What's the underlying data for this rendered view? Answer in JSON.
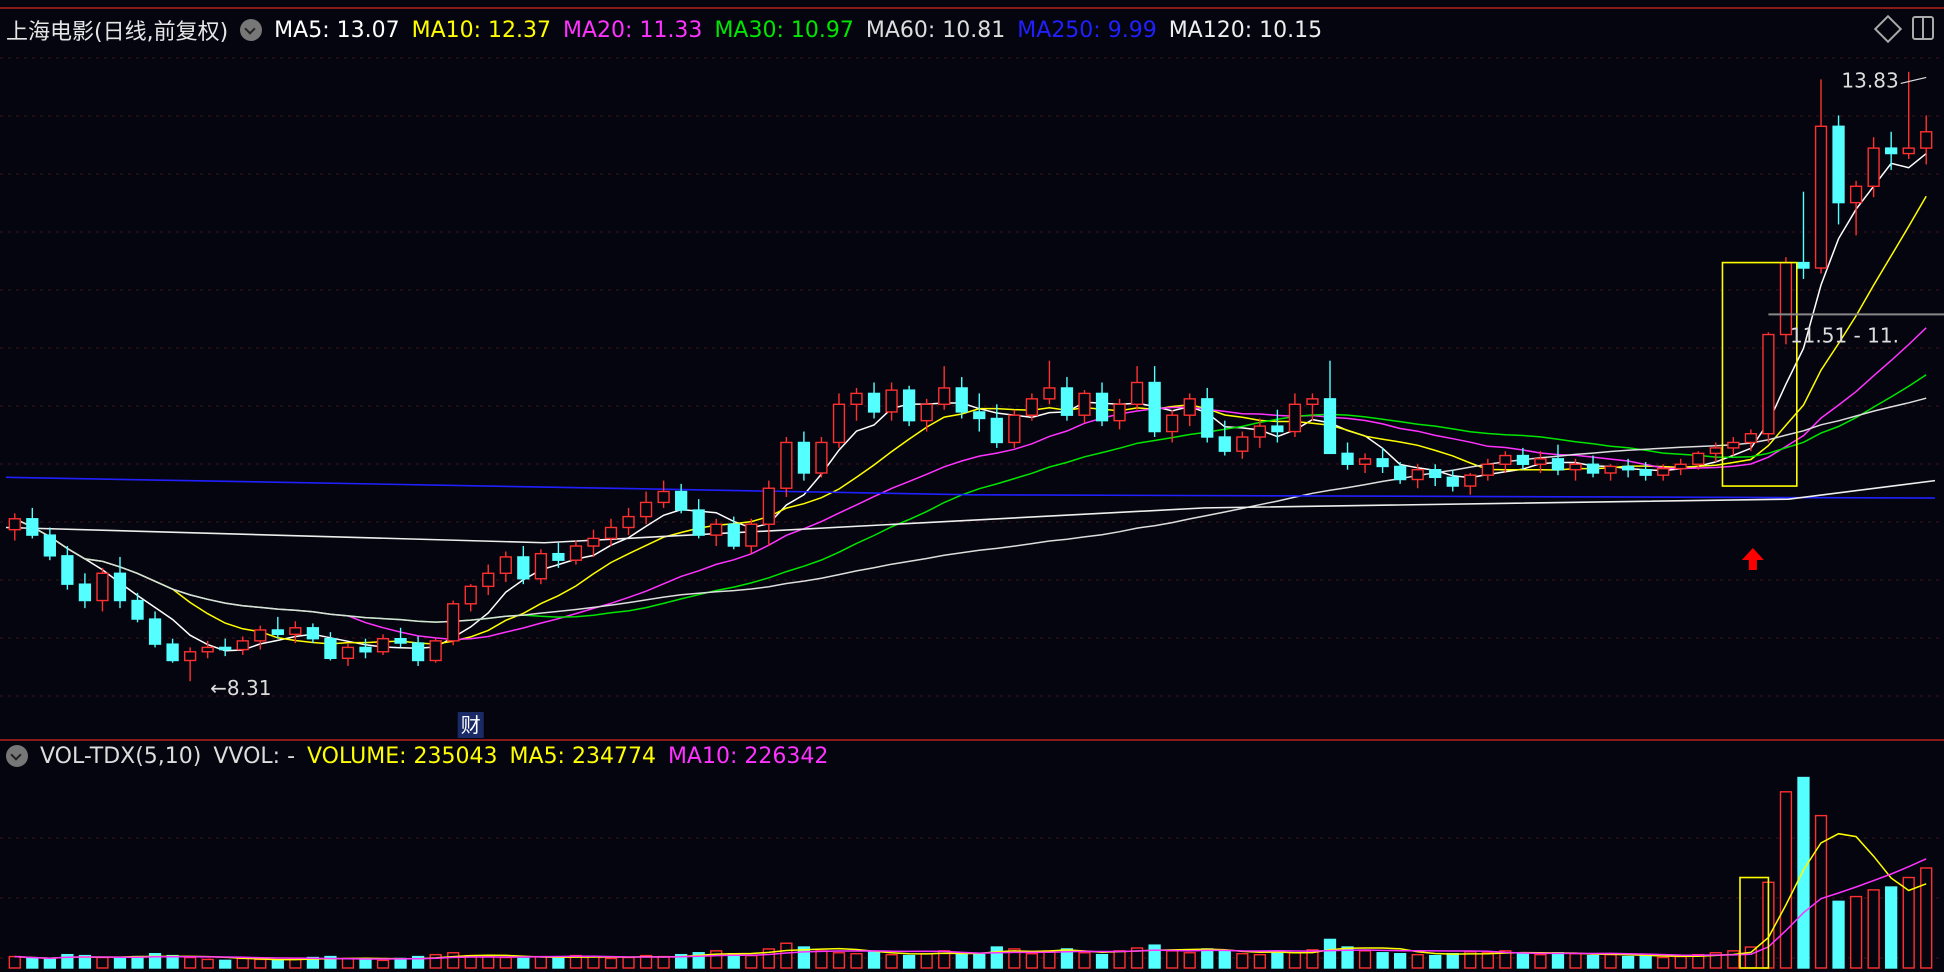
{
  "main_panel": {
    "title": "上海电影(日线,前复权)",
    "indicators": [
      {
        "label": "MA5: 13.07",
        "color": "#ffffff"
      },
      {
        "label": "MA10: 12.37",
        "color": "#ffff00"
      },
      {
        "label": "MA20: 11.33",
        "color": "#ff33ff"
      },
      {
        "label": "MA30: 10.97",
        "color": "#00e600"
      },
      {
        "label": "MA60: 10.81",
        "color": "#dddddd"
      },
      {
        "label": "MA250: 9.99",
        "color": "#2020ff"
      },
      {
        "label": "MA120: 10.15",
        "color": "#eeeeee"
      }
    ],
    "high_label": "13.83",
    "low_label": "8.31",
    "range_label": "11.51 - 11.",
    "event_marker": "财"
  },
  "volume_panel": {
    "title": "VOL-TDX(5,10)",
    "indicators": [
      {
        "label": "VVOL: -",
        "color": "#dddddd"
      },
      {
        "label": "VOLUME: 235043",
        "color": "#ffff00"
      },
      {
        "label": "MA5: 234774",
        "color": "#ffff00"
      },
      {
        "label": "MA10: 226342",
        "color": "#ff33ff"
      }
    ]
  },
  "colors": {
    "background": "#05050f",
    "up": "#ff3030",
    "down": "#54ffff",
    "grid": "#3a1414",
    "highlight_box": "#ffff00",
    "arrow": "#ff0000"
  },
  "chart_data": {
    "type": "candlestick",
    "title": "上海电影(日线,前复权)",
    "ylim": [
      8.0,
      14.1
    ],
    "moving_averages": [
      {
        "name": "MA5",
        "last": 13.07
      },
      {
        "name": "MA10",
        "last": 12.37
      },
      {
        "name": "MA20",
        "last": 11.33
      },
      {
        "name": "MA30",
        "last": 10.97
      },
      {
        "name": "MA60",
        "last": 10.81
      },
      {
        "name": "MA250",
        "last": 9.99
      },
      {
        "name": "MA120",
        "last": 10.15
      }
    ],
    "period_high": 13.83,
    "period_low": 8.31,
    "volume": {
      "last": 235043,
      "ma5": 234774,
      "ma10": 226342
    },
    "ohlc": [
      [
        9.7,
        9.85,
        9.6,
        9.8
      ],
      [
        9.8,
        9.9,
        9.62,
        9.65
      ],
      [
        9.65,
        9.72,
        9.42,
        9.46
      ],
      [
        9.46,
        9.55,
        9.15,
        9.2
      ],
      [
        9.2,
        9.3,
        8.98,
        9.05
      ],
      [
        9.05,
        9.35,
        8.95,
        9.3
      ],
      [
        9.3,
        9.45,
        8.98,
        9.05
      ],
      [
        9.05,
        9.12,
        8.85,
        8.88
      ],
      [
        8.88,
        8.95,
        8.62,
        8.65
      ],
      [
        8.65,
        8.7,
        8.48,
        8.5
      ],
      [
        8.5,
        8.62,
        8.31,
        8.58
      ],
      [
        8.58,
        8.68,
        8.52,
        8.62
      ],
      [
        8.62,
        8.7,
        8.54,
        8.6
      ],
      [
        8.6,
        8.72,
        8.55,
        8.68
      ],
      [
        8.68,
        8.82,
        8.6,
        8.78
      ],
      [
        8.78,
        8.9,
        8.7,
        8.74
      ],
      [
        8.74,
        8.86,
        8.66,
        8.8
      ],
      [
        8.8,
        8.84,
        8.66,
        8.7
      ],
      [
        8.7,
        8.76,
        8.5,
        8.52
      ],
      [
        8.52,
        8.66,
        8.45,
        8.62
      ],
      [
        8.62,
        8.7,
        8.52,
        8.58
      ],
      [
        8.58,
        8.74,
        8.55,
        8.7
      ],
      [
        8.7,
        8.8,
        8.62,
        8.66
      ],
      [
        8.66,
        8.72,
        8.45,
        8.5
      ],
      [
        8.5,
        8.7,
        8.48,
        8.68
      ],
      [
        8.68,
        9.05,
        8.64,
        9.02
      ],
      [
        9.02,
        9.2,
        8.95,
        9.18
      ],
      [
        9.18,
        9.38,
        9.1,
        9.3
      ],
      [
        9.3,
        9.5,
        9.22,
        9.45
      ],
      [
        9.45,
        9.55,
        9.2,
        9.25
      ],
      [
        9.25,
        9.52,
        9.2,
        9.48
      ],
      [
        9.48,
        9.58,
        9.35,
        9.42
      ],
      [
        9.42,
        9.6,
        9.38,
        9.55
      ],
      [
        9.55,
        9.7,
        9.45,
        9.62
      ],
      [
        9.62,
        9.8,
        9.55,
        9.72
      ],
      [
        9.72,
        9.9,
        9.65,
        9.82
      ],
      [
        9.82,
        10.05,
        9.75,
        9.95
      ],
      [
        9.95,
        10.15,
        9.9,
        10.05
      ],
      [
        10.05,
        10.12,
        9.85,
        9.88
      ],
      [
        9.88,
        9.98,
        9.62,
        9.65
      ],
      [
        9.65,
        9.8,
        9.55,
        9.75
      ],
      [
        9.75,
        9.82,
        9.52,
        9.55
      ],
      [
        9.55,
        9.8,
        9.48,
        9.75
      ],
      [
        9.75,
        10.15,
        9.55,
        10.08
      ],
      [
        10.08,
        10.55,
        10.0,
        10.5
      ],
      [
        10.5,
        10.6,
        10.15,
        10.22
      ],
      [
        10.22,
        10.55,
        10.18,
        10.5
      ],
      [
        10.5,
        10.95,
        10.45,
        10.85
      ],
      [
        10.85,
        11.0,
        10.7,
        10.95
      ],
      [
        10.95,
        11.05,
        10.72,
        10.78
      ],
      [
        10.78,
        11.05,
        10.7,
        10.98
      ],
      [
        10.98,
        11.02,
        10.65,
        10.7
      ],
      [
        10.7,
        10.9,
        10.6,
        10.85
      ],
      [
        10.85,
        11.2,
        10.8,
        11.0
      ],
      [
        11.0,
        11.1,
        10.72,
        10.78
      ],
      [
        10.78,
        10.95,
        10.6,
        10.72
      ],
      [
        10.72,
        10.85,
        10.45,
        10.5
      ],
      [
        10.5,
        10.8,
        10.45,
        10.75
      ],
      [
        10.75,
        10.95,
        10.7,
        10.9
      ],
      [
        10.9,
        11.25,
        10.85,
        11.0
      ],
      [
        11.0,
        11.1,
        10.7,
        10.75
      ],
      [
        10.75,
        10.98,
        10.68,
        10.95
      ],
      [
        10.95,
        11.05,
        10.65,
        10.7
      ],
      [
        10.7,
        10.9,
        10.62,
        10.85
      ],
      [
        10.85,
        11.2,
        10.8,
        11.05
      ],
      [
        11.05,
        11.2,
        10.55,
        10.6
      ],
      [
        10.6,
        10.8,
        10.5,
        10.75
      ],
      [
        10.75,
        10.95,
        10.65,
        10.9
      ],
      [
        10.9,
        11.0,
        10.5,
        10.55
      ],
      [
        10.55,
        10.7,
        10.38,
        10.42
      ],
      [
        10.42,
        10.6,
        10.35,
        10.55
      ],
      [
        10.55,
        10.72,
        10.45,
        10.65
      ],
      [
        10.65,
        10.8,
        10.5,
        10.6
      ],
      [
        10.6,
        10.95,
        10.55,
        10.85
      ],
      [
        10.85,
        10.95,
        10.7,
        10.9
      ],
      [
        10.9,
        11.25,
        10.85,
        10.4
      ],
      [
        10.4,
        10.5,
        10.25,
        10.3
      ],
      [
        10.3,
        10.4,
        10.22,
        10.35
      ],
      [
        10.35,
        10.45,
        10.22,
        10.28
      ],
      [
        10.28,
        10.32,
        10.12,
        10.16
      ],
      [
        10.16,
        10.3,
        10.08,
        10.25
      ],
      [
        10.25,
        10.3,
        10.1,
        10.18
      ],
      [
        10.18,
        10.25,
        10.05,
        10.1
      ],
      [
        10.1,
        10.22,
        10.02,
        10.2
      ],
      [
        10.2,
        10.35,
        10.15,
        10.3
      ],
      [
        10.3,
        10.42,
        10.22,
        10.38
      ],
      [
        10.38,
        10.45,
        10.25,
        10.3
      ],
      [
        10.3,
        10.42,
        10.22,
        10.35
      ],
      [
        10.35,
        10.48,
        10.2,
        10.25
      ],
      [
        10.25,
        10.35,
        10.15,
        10.3
      ],
      [
        10.3,
        10.38,
        10.18,
        10.22
      ],
      [
        10.22,
        10.3,
        10.15,
        10.28
      ],
      [
        10.28,
        10.35,
        10.18,
        10.25
      ],
      [
        10.25,
        10.32,
        10.15,
        10.2
      ],
      [
        10.2,
        10.3,
        10.15,
        10.26
      ],
      [
        10.26,
        10.35,
        10.2,
        10.3
      ],
      [
        10.3,
        10.42,
        10.25,
        10.4
      ],
      [
        10.4,
        10.5,
        10.32,
        10.45
      ],
      [
        10.45,
        10.55,
        10.38,
        10.5
      ],
      [
        10.5,
        10.62,
        10.42,
        10.58
      ],
      [
        10.58,
        11.51,
        10.5,
        11.49
      ],
      [
        11.49,
        12.2,
        11.4,
        12.15
      ],
      [
        12.15,
        12.8,
        12.0,
        12.1
      ],
      [
        12.1,
        13.83,
        12.05,
        13.4
      ],
      [
        13.4,
        13.5,
        12.5,
        12.7
      ],
      [
        12.7,
        12.9,
        12.4,
        12.85
      ],
      [
        12.85,
        13.3,
        12.75,
        13.2
      ],
      [
        13.2,
        13.35,
        13.0,
        13.15
      ],
      [
        13.15,
        13.9,
        13.1,
        13.2
      ],
      [
        13.2,
        13.5,
        13.05,
        13.35
      ]
    ],
    "volumes": [
      12,
      10,
      9,
      14,
      13,
      11,
      10,
      12,
      15,
      13,
      11,
      9,
      8,
      10,
      9,
      8,
      9,
      11,
      12,
      10,
      9,
      8,
      10,
      12,
      14,
      16,
      13,
      12,
      11,
      10,
      12,
      11,
      13,
      12,
      10,
      11,
      13,
      12,
      14,
      16,
      18,
      15,
      13,
      20,
      26,
      22,
      18,
      16,
      15,
      17,
      14,
      13,
      15,
      18,
      16,
      14,
      22,
      20,
      15,
      18,
      20,
      16,
      14,
      18,
      21,
      24,
      18,
      16,
      20,
      18,
      15,
      14,
      17,
      16,
      19,
      30,
      22,
      18,
      16,
      15,
      14,
      13,
      15,
      17,
      16,
      18,
      15,
      14,
      16,
      15,
      13,
      14,
      12,
      13,
      11,
      12,
      14,
      16,
      18,
      22,
      90,
      185,
      200,
      160,
      70,
      75,
      82,
      85,
      95,
      105
    ]
  }
}
